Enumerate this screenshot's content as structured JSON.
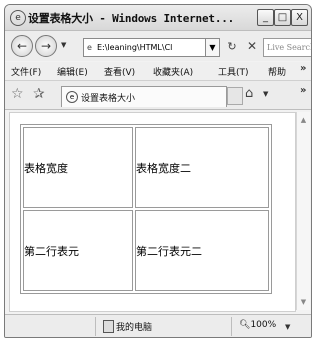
{
  "window": {
    "title": "设置表格大小 - Windows Internet...",
    "buttons": [
      "_",
      "□",
      "X"
    ]
  },
  "address_bar": {
    "url": "E:\\leaning\\HTML\\Cl",
    "search_placeholder": "Live Search"
  },
  "menu": [
    "文件(F)",
    "编辑(E)",
    "查看(V)",
    "收藏夹(A)",
    "工具(T)",
    "帮助"
  ],
  "tab": {
    "title": "设置表格大小"
  },
  "table": {
    "rows": [
      [
        "表格宽度",
        "表格宽度二"
      ],
      [
        "第二行表元",
        "第二行表元二"
      ]
    ]
  },
  "status": {
    "zone": "我的电脑",
    "zoom": "100%"
  },
  "icons": {
    "title": "ie-page-icon",
    "back": "back-arrow-icon",
    "forward": "forward-arrow-icon",
    "refresh": "refresh-icon",
    "stop": "stop-icon",
    "favorites": "star-icon",
    "add_favorite": "add-favorite-icon",
    "home": "home-icon",
    "zone": "computer-icon",
    "zoom": "magnifier-icon"
  }
}
